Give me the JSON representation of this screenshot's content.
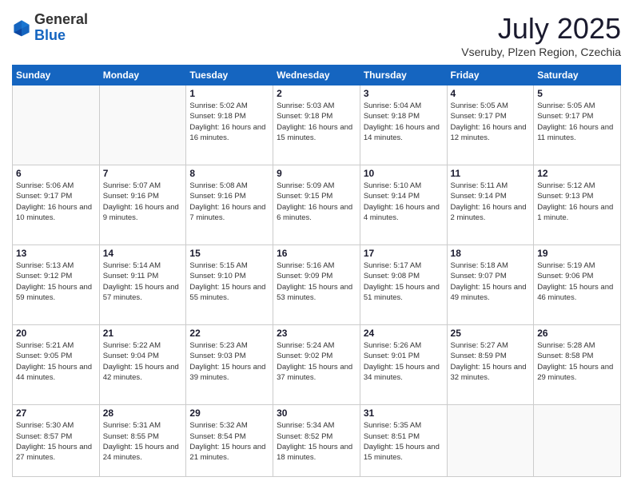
{
  "header": {
    "logo_general": "General",
    "logo_blue": "Blue",
    "month_year": "July 2025",
    "location": "Vseruby, Plzen Region, Czechia"
  },
  "weekdays": [
    "Sunday",
    "Monday",
    "Tuesday",
    "Wednesday",
    "Thursday",
    "Friday",
    "Saturday"
  ],
  "weeks": [
    [
      {
        "day": "",
        "info": ""
      },
      {
        "day": "",
        "info": ""
      },
      {
        "day": "1",
        "info": "Sunrise: 5:02 AM\nSunset: 9:18 PM\nDaylight: 16 hours and 16 minutes."
      },
      {
        "day": "2",
        "info": "Sunrise: 5:03 AM\nSunset: 9:18 PM\nDaylight: 16 hours and 15 minutes."
      },
      {
        "day": "3",
        "info": "Sunrise: 5:04 AM\nSunset: 9:18 PM\nDaylight: 16 hours and 14 minutes."
      },
      {
        "day": "4",
        "info": "Sunrise: 5:05 AM\nSunset: 9:17 PM\nDaylight: 16 hours and 12 minutes."
      },
      {
        "day": "5",
        "info": "Sunrise: 5:05 AM\nSunset: 9:17 PM\nDaylight: 16 hours and 11 minutes."
      }
    ],
    [
      {
        "day": "6",
        "info": "Sunrise: 5:06 AM\nSunset: 9:17 PM\nDaylight: 16 hours and 10 minutes."
      },
      {
        "day": "7",
        "info": "Sunrise: 5:07 AM\nSunset: 9:16 PM\nDaylight: 16 hours and 9 minutes."
      },
      {
        "day": "8",
        "info": "Sunrise: 5:08 AM\nSunset: 9:16 PM\nDaylight: 16 hours and 7 minutes."
      },
      {
        "day": "9",
        "info": "Sunrise: 5:09 AM\nSunset: 9:15 PM\nDaylight: 16 hours and 6 minutes."
      },
      {
        "day": "10",
        "info": "Sunrise: 5:10 AM\nSunset: 9:14 PM\nDaylight: 16 hours and 4 minutes."
      },
      {
        "day": "11",
        "info": "Sunrise: 5:11 AM\nSunset: 9:14 PM\nDaylight: 16 hours and 2 minutes."
      },
      {
        "day": "12",
        "info": "Sunrise: 5:12 AM\nSunset: 9:13 PM\nDaylight: 16 hours and 1 minute."
      }
    ],
    [
      {
        "day": "13",
        "info": "Sunrise: 5:13 AM\nSunset: 9:12 PM\nDaylight: 15 hours and 59 minutes."
      },
      {
        "day": "14",
        "info": "Sunrise: 5:14 AM\nSunset: 9:11 PM\nDaylight: 15 hours and 57 minutes."
      },
      {
        "day": "15",
        "info": "Sunrise: 5:15 AM\nSunset: 9:10 PM\nDaylight: 15 hours and 55 minutes."
      },
      {
        "day": "16",
        "info": "Sunrise: 5:16 AM\nSunset: 9:09 PM\nDaylight: 15 hours and 53 minutes."
      },
      {
        "day": "17",
        "info": "Sunrise: 5:17 AM\nSunset: 9:08 PM\nDaylight: 15 hours and 51 minutes."
      },
      {
        "day": "18",
        "info": "Sunrise: 5:18 AM\nSunset: 9:07 PM\nDaylight: 15 hours and 49 minutes."
      },
      {
        "day": "19",
        "info": "Sunrise: 5:19 AM\nSunset: 9:06 PM\nDaylight: 15 hours and 46 minutes."
      }
    ],
    [
      {
        "day": "20",
        "info": "Sunrise: 5:21 AM\nSunset: 9:05 PM\nDaylight: 15 hours and 44 minutes."
      },
      {
        "day": "21",
        "info": "Sunrise: 5:22 AM\nSunset: 9:04 PM\nDaylight: 15 hours and 42 minutes."
      },
      {
        "day": "22",
        "info": "Sunrise: 5:23 AM\nSunset: 9:03 PM\nDaylight: 15 hours and 39 minutes."
      },
      {
        "day": "23",
        "info": "Sunrise: 5:24 AM\nSunset: 9:02 PM\nDaylight: 15 hours and 37 minutes."
      },
      {
        "day": "24",
        "info": "Sunrise: 5:26 AM\nSunset: 9:01 PM\nDaylight: 15 hours and 34 minutes."
      },
      {
        "day": "25",
        "info": "Sunrise: 5:27 AM\nSunset: 8:59 PM\nDaylight: 15 hours and 32 minutes."
      },
      {
        "day": "26",
        "info": "Sunrise: 5:28 AM\nSunset: 8:58 PM\nDaylight: 15 hours and 29 minutes."
      }
    ],
    [
      {
        "day": "27",
        "info": "Sunrise: 5:30 AM\nSunset: 8:57 PM\nDaylight: 15 hours and 27 minutes."
      },
      {
        "day": "28",
        "info": "Sunrise: 5:31 AM\nSunset: 8:55 PM\nDaylight: 15 hours and 24 minutes."
      },
      {
        "day": "29",
        "info": "Sunrise: 5:32 AM\nSunset: 8:54 PM\nDaylight: 15 hours and 21 minutes."
      },
      {
        "day": "30",
        "info": "Sunrise: 5:34 AM\nSunset: 8:52 PM\nDaylight: 15 hours and 18 minutes."
      },
      {
        "day": "31",
        "info": "Sunrise: 5:35 AM\nSunset: 8:51 PM\nDaylight: 15 hours and 15 minutes."
      },
      {
        "day": "",
        "info": ""
      },
      {
        "day": "",
        "info": ""
      }
    ]
  ]
}
